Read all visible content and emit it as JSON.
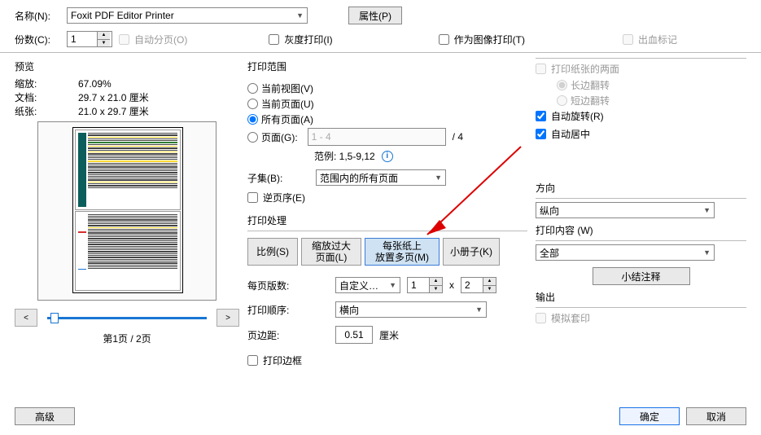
{
  "top": {
    "name_label": "名称(N):",
    "printer": "Foxit PDF Editor Printer",
    "properties": "属性(P)",
    "copies_label": "份数(C):",
    "copies_value": "1",
    "collate": "自动分页(O)",
    "grayscale": "灰度打印(I)",
    "print_as_image": "作为图像打印(T)",
    "bleed_marks": "出血标记"
  },
  "preview": {
    "title": "预览",
    "zoom_label": "缩放:",
    "zoom_value": "67.09%",
    "doc_label": "文档:",
    "doc_value": "29.7 x 21.0 厘米",
    "paper_label": "纸张:",
    "paper_value": "21.0 x 29.7 厘米",
    "page_status": "第1页 / 2页"
  },
  "range": {
    "title": "打印范围",
    "current_view": "当前视图(V)",
    "current_page": "当前页面(U)",
    "all_pages": "所有页面(A)",
    "pages_label": "页面(G):",
    "pages_value": "1 - 4",
    "pages_total": "/ 4",
    "sample": "范例: 1,5-9,12",
    "subset_label": "子集(B):",
    "subset_value": "范围内的所有页面",
    "reverse": "逆页序(E)"
  },
  "handling": {
    "title": "打印处理",
    "tab_scale": "比例(S)",
    "tab_poster": "缩放过大\n页面(L)",
    "tab_multi": "每张纸上\n放置多页(M)",
    "tab_booklet": "小册子(K)",
    "pages_per_sheet_label": "每页版数:",
    "custom": "自定义…",
    "ncols": "1",
    "x": "x",
    "nrows": "2",
    "order_label": "打印顺序:",
    "order_value": "横向",
    "margin_label": "页边距:",
    "margin_value": "0.51",
    "margin_unit": "厘米",
    "print_border": "打印边框"
  },
  "right": {
    "both_sides": "打印纸张的两面",
    "flip_long": "长边翻转",
    "flip_short": "短边翻转",
    "auto_rotate": "自动旋转(R)",
    "auto_center": "自动居中",
    "orientation_title": "方向",
    "orientation_value": "纵向",
    "content_title": "打印内容 (W)",
    "content_value": "全部",
    "summarize": "小结注释",
    "output_title": "输出",
    "simulate": "模拟套印"
  },
  "footer": {
    "advanced": "高级",
    "ok": "确定",
    "cancel": "取消"
  }
}
